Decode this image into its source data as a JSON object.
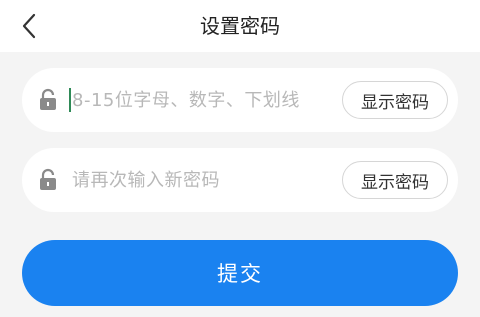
{
  "header": {
    "title": "设置密码",
    "back_icon": "chevron-left-icon"
  },
  "form": {
    "password": {
      "placeholder": "8-15位字母、数字、下划线",
      "value": "",
      "icon": "lock-icon",
      "show_label": "显示密码"
    },
    "confirm": {
      "placeholder": "请再次输入新密码",
      "value": "",
      "icon": "lock-icon",
      "show_label": "显示密码"
    },
    "submit_label": "提交"
  },
  "colors": {
    "accent": "#1a82f0",
    "background": "#f4f4f4",
    "placeholder": "#b8b8b8"
  }
}
